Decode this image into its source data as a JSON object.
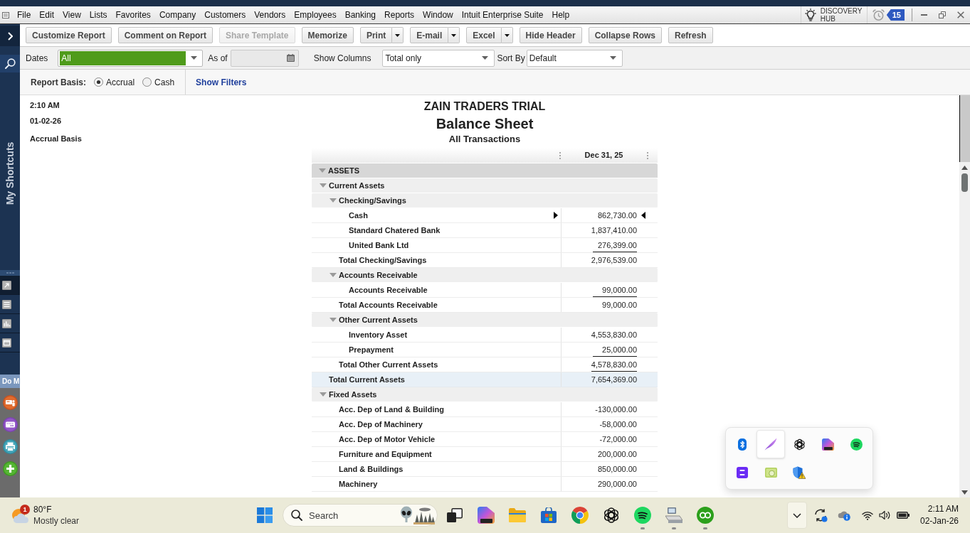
{
  "menu_bar": {
    "items": [
      "File",
      "Edit",
      "View",
      "Lists",
      "Favorites",
      "Company",
      "Customers",
      "Vendors",
      "Employees",
      "Banking",
      "Reports",
      "Window",
      "Intuit Enterprise Suite",
      "Help"
    ],
    "discovery_hub": "DISCOVERY HUB",
    "reminders_badge": "15"
  },
  "sidebar": {
    "title": "My Shortcuts",
    "tabs": [
      {
        "kind": "shortcuts",
        "selected": true
      },
      {
        "kind": "list",
        "selected": false
      },
      {
        "kind": "chart",
        "selected": false
      },
      {
        "kind": "window",
        "selected": false
      }
    ],
    "do_more": {
      "label": "Do M",
      "actions": [
        {
          "kind": "id_card"
        },
        {
          "kind": "card"
        },
        {
          "kind": "printer"
        },
        {
          "kind": "add"
        }
      ]
    }
  },
  "toolbar": {
    "buttons": [
      {
        "label": "Customize Report",
        "disabled": false,
        "dropdown": false
      },
      {
        "label": "Comment on Report",
        "disabled": false,
        "dropdown": false
      },
      {
        "label": "Share Template",
        "disabled": true,
        "dropdown": false
      },
      {
        "label": "Memorize",
        "disabled": false,
        "dropdown": false
      },
      {
        "label": "Print",
        "disabled": false,
        "dropdown": true
      },
      {
        "label": "E-mail",
        "disabled": false,
        "dropdown": true
      },
      {
        "label": "Excel",
        "disabled": false,
        "dropdown": true
      },
      {
        "label": "Hide Header",
        "disabled": false,
        "dropdown": false
      },
      {
        "label": "Collapse Rows",
        "disabled": false,
        "dropdown": false
      },
      {
        "label": "Refresh",
        "disabled": false,
        "dropdown": false
      }
    ]
  },
  "filters": {
    "dates": {
      "label": "Dates",
      "value": "All",
      "highlighted": true
    },
    "as_of": {
      "label": "As of",
      "disabled": true
    },
    "show_columns": {
      "label": "Show Columns",
      "value": "Total only"
    },
    "sort_by": {
      "label": "Sort By",
      "value": "Default"
    }
  },
  "report_basis": {
    "label": "Report Basis:",
    "options": [
      {
        "label": "Accrual",
        "selected": true
      },
      {
        "label": "Cash",
        "selected": false
      }
    ],
    "show_filters": "Show Filters"
  },
  "report": {
    "time": "2:10 AM",
    "date": "01-02-26",
    "basis": "Accrual Basis",
    "company": "ZAIN TRADERS TRIAL",
    "title": "Balance Sheet",
    "subtitle": "All Transactions",
    "columns": [
      "Dec 31, 25"
    ],
    "rows": [
      {
        "kind": "section",
        "label": "ASSETS",
        "expanded": true,
        "selected": false,
        "children": [
          {
            "kind": "group",
            "label": "Current Assets",
            "expanded": true,
            "selected": false,
            "children": [
              {
                "kind": "group",
                "label": "Checking/Savings",
                "expanded": true,
                "selected": false,
                "children": [
                  {
                    "kind": "account",
                    "label": "Cash",
                    "amount": "862,730.00",
                    "selected": true
                  },
                  {
                    "kind": "account",
                    "label": "Standard Chatered Bank",
                    "amount": "1,837,410.00",
                    "selected": false
                  },
                  {
                    "kind": "account",
                    "label": "United Bank Ltd",
                    "amount": "276,399.00",
                    "selected": false
                  }
                ],
                "total": {
                  "label": "Total Checking/Savings",
                  "amount": "2,976,539.00",
                  "selected": false,
                  "highlighted": false
                }
              },
              {
                "kind": "group",
                "label": "Accounts Receivable",
                "expanded": true,
                "selected": false,
                "children": [
                  {
                    "kind": "account",
                    "label": "Accounts Receivable",
                    "amount": "99,000.00",
                    "selected": false
                  }
                ],
                "total": {
                  "label": "Total Accounts Receivable",
                  "amount": "99,000.00",
                  "selected": false,
                  "highlighted": false
                }
              },
              {
                "kind": "group",
                "label": "Other Current Assets",
                "expanded": true,
                "selected": false,
                "children": [
                  {
                    "kind": "account",
                    "label": "Inventory Asset",
                    "amount": "4,553,830.00",
                    "selected": false
                  },
                  {
                    "kind": "account",
                    "label": "Prepayment",
                    "amount": "25,000.00",
                    "selected": false
                  }
                ],
                "total": {
                  "label": "Total Other Current Assets",
                  "amount": "4,578,830.00",
                  "selected": false,
                  "highlighted": false
                }
              }
            ],
            "total": {
              "label": "Total Current Assets",
              "amount": "7,654,369.00",
              "selected": false,
              "highlighted": true
            }
          },
          {
            "kind": "group",
            "label": "Fixed Assets",
            "expanded": true,
            "selected": false,
            "children": [
              {
                "kind": "account",
                "label": "Acc. Dep of Land & Building",
                "amount": "-130,000.00",
                "selected": false
              },
              {
                "kind": "account",
                "label": "Acc. Dep of Machinery",
                "amount": "-58,000.00",
                "selected": false
              },
              {
                "kind": "account",
                "label": "Acc. Dep of Motor Vehicle",
                "amount": "-72,000.00",
                "selected": false
              },
              {
                "kind": "account",
                "label": "Furniture and Equipment",
                "amount": "200,000.00",
                "selected": false
              },
              {
                "kind": "account",
                "label": "Land & Buildings",
                "amount": "850,000.00",
                "selected": false
              },
              {
                "kind": "account",
                "label": "Machinery",
                "amount": "290,000.00",
                "selected": false
              }
            ]
          }
        ]
      }
    ]
  },
  "taskbar": {
    "weather": {
      "badge": "1",
      "temperature": "80°F",
      "condition": "Mostly clear"
    },
    "search": {
      "placeholder": "Search"
    },
    "apps": [
      {
        "kind": "task_view",
        "running": false
      },
      {
        "kind": "m365",
        "running": false
      },
      {
        "kind": "file_explorer",
        "running": false
      },
      {
        "kind": "store",
        "running": false
      },
      {
        "kind": "browser",
        "running": false
      },
      {
        "kind": "chatgpt",
        "running": false
      },
      {
        "kind": "spotify",
        "running": true
      },
      {
        "kind": "computer",
        "running": true
      },
      {
        "kind": "quickbooks",
        "running": true
      }
    ],
    "tray_expanded": true,
    "clock": {
      "time": "2:11 AM",
      "date": "02-Jan-26"
    }
  },
  "tray_overflow": {
    "icons": [
      {
        "kind": "bluetooth",
        "hovered": false
      },
      {
        "kind": "feather",
        "hovered": true
      },
      {
        "kind": "chatgpt",
        "hovered": false
      },
      {
        "kind": "m365",
        "hovered": false
      },
      {
        "kind": "spotify",
        "hovered": false
      },
      {
        "kind": "e_app",
        "hovered": false
      },
      {
        "kind": "green_card",
        "hovered": false
      },
      {
        "kind": "security_warning",
        "hovered": false
      }
    ]
  }
}
